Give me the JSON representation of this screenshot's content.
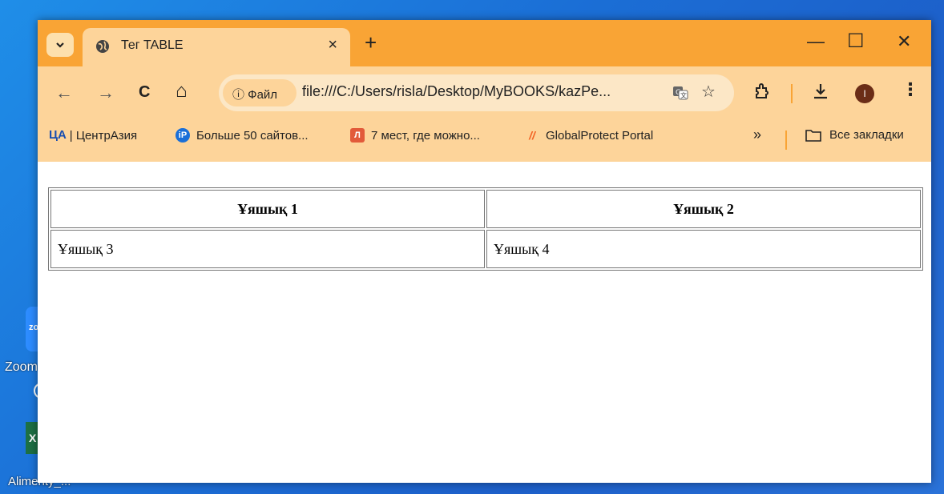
{
  "desktop": {
    "zoom_icon_text": "zo",
    "zoom_label": "Zoom",
    "excel_icon_text": "X",
    "excel_label": "Alimenty_..."
  },
  "browser": {
    "tab_title": "Тег TABLE",
    "tab_close": "×",
    "new_tab": "+",
    "window_buttons": {
      "minimize": "—",
      "maximize": "☐",
      "close": "✕"
    },
    "toolbar": {
      "back": "←",
      "forward": "→",
      "reload": "C",
      "home": "⌂",
      "site_chip": "ⓘ Файл",
      "url": "file:///C:/Users/risla/Desktop/MyBOOKS/kazPe...",
      "translate_icon": "translate-icon",
      "star": "☆",
      "extensions": "extensions-icon",
      "download": "⤓",
      "profile_initial": "I",
      "menu": "⋮"
    },
    "bookmarks": [
      {
        "icon_text": "ЦА",
        "label": "| ЦентрАзия",
        "color": "#1a4fb0"
      },
      {
        "icon_text": "iP",
        "label": "Больше 50 сайтов...",
        "color": "#1a6fd8"
      },
      {
        "icon_text": "Л",
        "label": "7 мест, где можно...",
        "color": "#e25a3a"
      },
      {
        "icon_text": "//",
        "label": "GlobalProtect Portal",
        "color": "#f26122"
      }
    ],
    "bookmarks_more": "»",
    "all_bookmarks": "Все закладки",
    "accent_color": "#f9a435",
    "toolbar_color": "#fdd49a"
  },
  "page": {
    "table": {
      "headers": [
        "Ұяшық 1",
        "Ұяшық 2"
      ],
      "rows": [
        [
          "Ұяшық 3",
          "Ұяшық 4"
        ]
      ]
    }
  }
}
